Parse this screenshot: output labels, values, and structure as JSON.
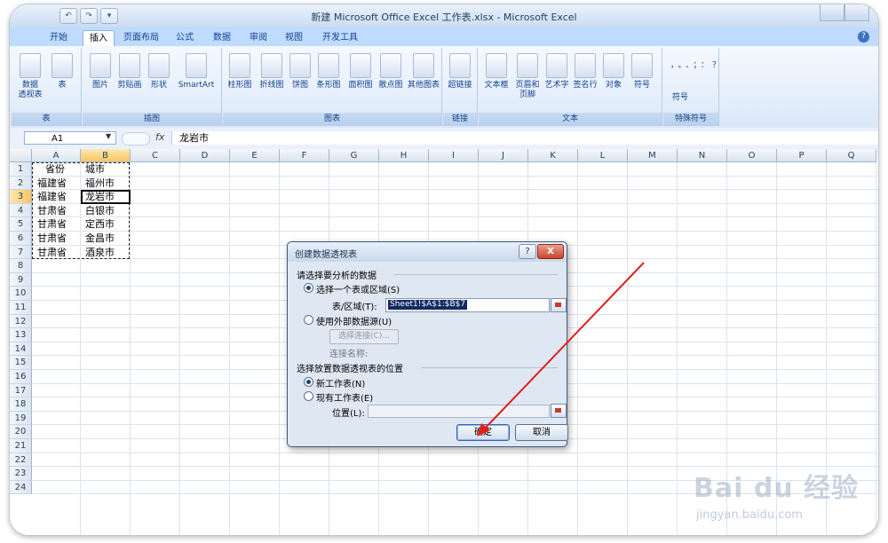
{
  "window": {
    "title": "新建 Microsoft Office Excel 工作表.xlsx - Microsoft Excel"
  },
  "ribbon": {
    "tabs": [
      "开始",
      "插入",
      "页面布局",
      "公式",
      "数据",
      "审阅",
      "视图",
      "开发工具"
    ],
    "active_tab": "插入",
    "groups": [
      {
        "label": "表",
        "buttons": [
          "数据\n透视表",
          "表"
        ]
      },
      {
        "label": "插图",
        "buttons": [
          "图片",
          "剪贴画",
          "形状",
          "SmartArt"
        ]
      },
      {
        "label": "图表",
        "buttons": [
          "柱形图",
          "折线图",
          "饼图",
          "条形图",
          "面积图",
          "散点图",
          "其他图表"
        ]
      },
      {
        "label": "链接",
        "buttons": [
          "超链接"
        ]
      },
      {
        "label": "文本",
        "buttons": [
          "文本框",
          "页眉和\n页脚",
          "艺术字",
          "签名行",
          "对象",
          "符号"
        ]
      },
      {
        "label": "特殊符号",
        "buttons": [
          "符号"
        ]
      }
    ],
    "special_symbols": "，。、；：？"
  },
  "formula_bar": {
    "name_box": "A1",
    "fx": "fx",
    "content": "龙岩市"
  },
  "sheet": {
    "columns": [
      "A",
      "B",
      "C",
      "D",
      "E",
      "F",
      "G",
      "H",
      "I",
      "J",
      "K",
      "L",
      "M",
      "N",
      "O",
      "P",
      "Q"
    ],
    "rows": [
      "1",
      "2",
      "3",
      "4",
      "5",
      "6",
      "7",
      "8",
      "9",
      "10",
      "11",
      "12",
      "13",
      "14",
      "15",
      "16",
      "17",
      "18",
      "19",
      "20",
      "21",
      "22",
      "23",
      "24"
    ],
    "selected_column": "B",
    "selected_row": "3",
    "cells": [
      [
        "省份",
        "城市"
      ],
      [
        "福建省",
        "福州市"
      ],
      [
        "福建省",
        "龙岩市"
      ],
      [
        "甘肃省",
        "白银市"
      ],
      [
        "甘肃省",
        "定西市"
      ],
      [
        "甘肃省",
        "金昌市"
      ],
      [
        "甘肃省",
        "酒泉市"
      ]
    ]
  },
  "dialog": {
    "title": "创建数据透视表",
    "help": "?",
    "close": "X",
    "section1": "请选择要分析的数据",
    "option_table": "选择一个表或区域(S)",
    "table_range_label": "表/区域(T):",
    "table_range_value": "Sheet1!$A$1:$B$7",
    "option_external": "使用外部数据源(U)",
    "choose_connection": "选择连接(C)...",
    "connection_name": "连接名称:",
    "section2": "选择放置数据透视表的位置",
    "option_new_sheet": "新工作表(N)",
    "option_existing_sheet": "现有工作表(E)",
    "location_label": "位置(L):",
    "location_value": "",
    "ok": "确定",
    "cancel": "取消"
  },
  "annotation": {
    "arrow_color": "#e02020"
  },
  "watermark": {
    "text": "Bai du 经验",
    "url": "jingyan.baidu.com"
  }
}
